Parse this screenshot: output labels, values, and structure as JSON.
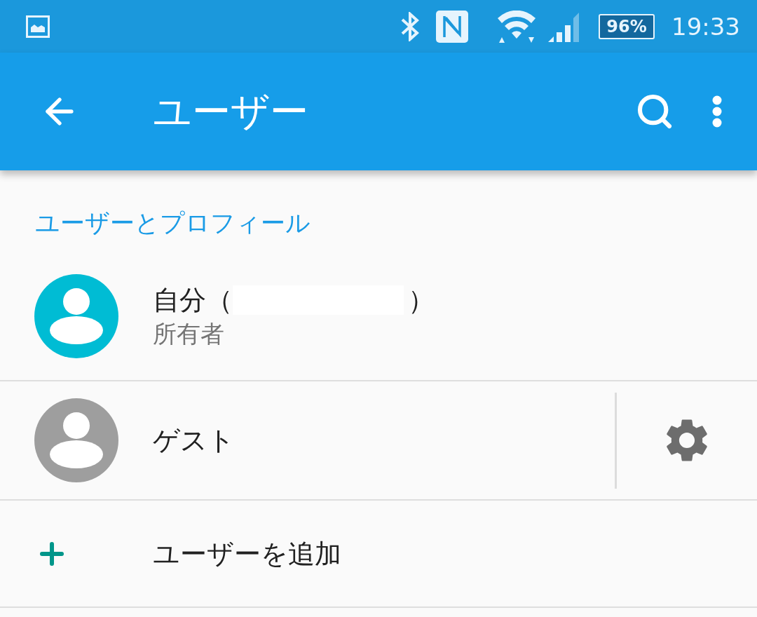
{
  "status_bar": {
    "battery_text": "96%",
    "time": "19:33"
  },
  "app_bar": {
    "title": "ユーザー"
  },
  "section_header": "ユーザーとプロフィール",
  "users": [
    {
      "kind": "owner",
      "name_parts": [
        "自分（",
        "）"
      ],
      "subtitle": "所有者",
      "color": "#00bcd4",
      "has_settings": false
    },
    {
      "kind": "guest",
      "name_parts": [
        "ゲスト"
      ],
      "color": "#9e9e9e",
      "has_settings": true
    }
  ],
  "add_user": {
    "label": "ユーザーを追加"
  }
}
